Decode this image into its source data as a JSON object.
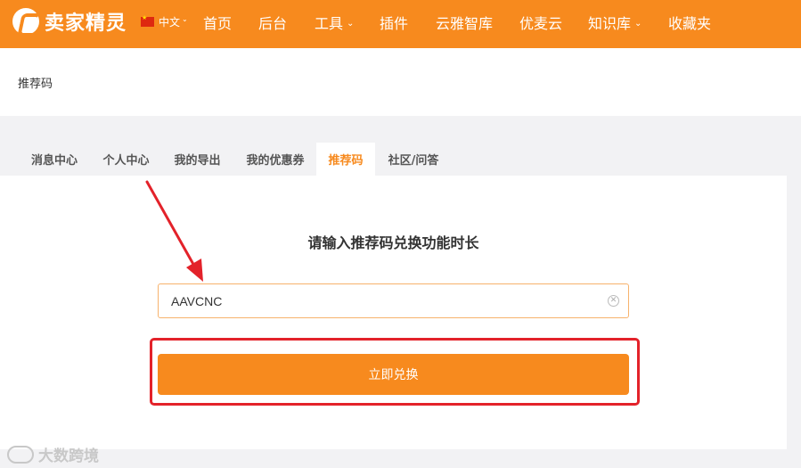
{
  "header": {
    "brand": "卖家精灵",
    "language": "中文",
    "nav": [
      {
        "label": "首页",
        "name": "nav-home",
        "has_dropdown": false
      },
      {
        "label": "后台",
        "name": "nav-dashboard",
        "has_dropdown": false
      },
      {
        "label": "工具",
        "name": "nav-tools",
        "has_dropdown": true
      },
      {
        "label": "插件",
        "name": "nav-plugins",
        "has_dropdown": false
      },
      {
        "label": "云雅智库",
        "name": "nav-yunya-library",
        "has_dropdown": false
      },
      {
        "label": "优麦云",
        "name": "nav-youmaiyun",
        "has_dropdown": false
      },
      {
        "label": "知识库",
        "name": "nav-knowledge-base",
        "has_dropdown": true
      },
      {
        "label": "收藏夹",
        "name": "nav-favorites",
        "has_dropdown": false
      }
    ]
  },
  "breadcrumb": {
    "current": "推荐码"
  },
  "tabs": [
    {
      "label": "消息中心",
      "active": false
    },
    {
      "label": "个人中心",
      "active": false
    },
    {
      "label": "我的导出",
      "active": false
    },
    {
      "label": "我的优惠券",
      "active": false
    },
    {
      "label": "推荐码",
      "active": true
    },
    {
      "label": "社区/问答",
      "active": false
    }
  ],
  "redeem": {
    "heading": "请输入推荐码兑换功能时长",
    "code_value": "AAVCNC",
    "button_label": "立即兑换"
  },
  "watermark": {
    "text": "大数跨境"
  },
  "colors": {
    "brand": "#f78a1e",
    "annotation": "#e3222a"
  },
  "icons": {
    "clear": "clear-circle-icon",
    "dropdown": "chevron-down-icon"
  }
}
